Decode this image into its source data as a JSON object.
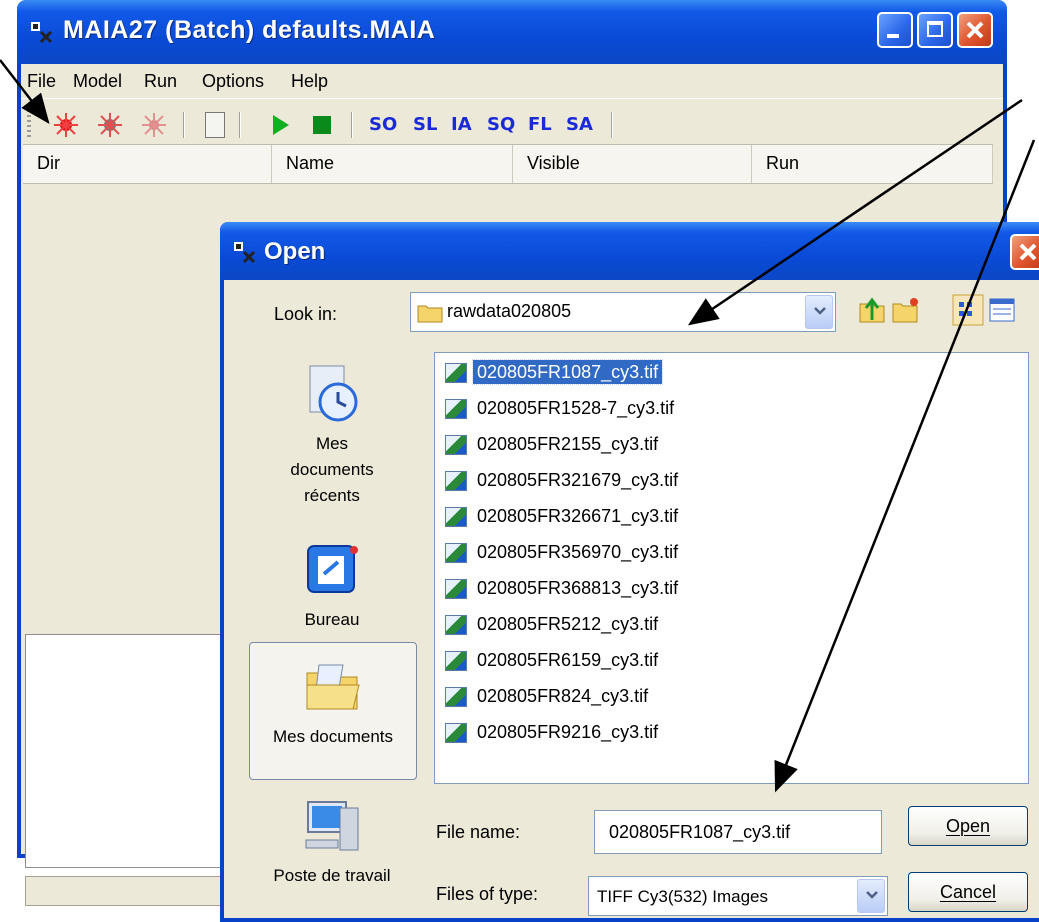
{
  "main_window": {
    "title": "MAIA27 (Batch) defaults.MAIA",
    "menu": [
      "File",
      "Model",
      "Run",
      "Options",
      "Help"
    ],
    "toolbar_text_buttons": [
      "SO",
      "SL",
      "IA",
      "SQ",
      "FL",
      "SA"
    ],
    "columns": [
      "Dir",
      "Name",
      "Visible",
      "Run"
    ]
  },
  "open_dialog": {
    "title": "Open",
    "look_in_label": "Look in:",
    "look_in_value": "rawdata020805",
    "places": [
      "Mes documents récents",
      "Bureau",
      "Mes documents",
      "Poste de travail"
    ],
    "files": [
      "020805FR1087_cy3.tif",
      "020805FR1528-7_cy3.tif",
      "020805FR2155_cy3.tif",
      "020805FR321679_cy3.tif",
      "020805FR326671_cy3.tif",
      "020805FR356970_cy3.tif",
      "020805FR368813_cy3.tif",
      "020805FR5212_cy3.tif",
      "020805FR6159_cy3.tif",
      "020805FR824_cy3.tif",
      "020805FR9216_cy3.tif"
    ],
    "selected_file_index": 0,
    "file_name_label": "File name:",
    "file_name_value": "020805FR1087_cy3.tif",
    "file_type_label": "Files of type:",
    "file_type_value": "TIFF Cy3(532) Images",
    "open_button": "Open",
    "cancel_button": "Cancel"
  },
  "colors": {
    "titlebar": "#0a4bd6",
    "selection": "#316ac5",
    "toolbar_text": "#1a2ad8",
    "play_green": "#10b020"
  }
}
